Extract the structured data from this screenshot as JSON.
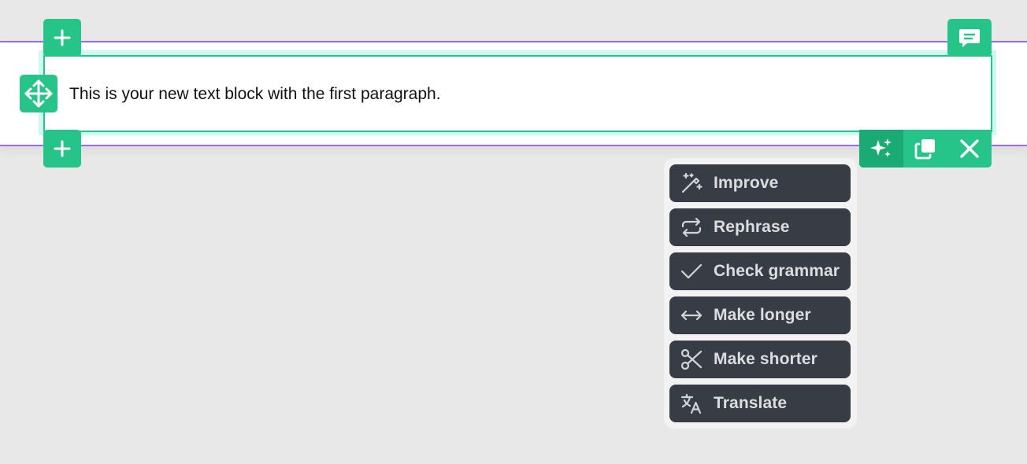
{
  "block": {
    "text": "This is your new text block with the first paragraph."
  },
  "controls": {
    "add_above_icon": "plus-icon",
    "add_below_icon": "plus-icon",
    "move_icon": "move-arrows-icon",
    "comment_icon": "comment-icon"
  },
  "toolbar": {
    "ai_icon": "sparkles-icon",
    "duplicate_icon": "duplicate-icon",
    "delete_icon": "close-icon"
  },
  "ai_menu": {
    "items": [
      {
        "label": "Improve",
        "icon": "magic-wand-icon"
      },
      {
        "label": "Rephrase",
        "icon": "repeat-icon"
      },
      {
        "label": "Check grammar",
        "icon": "checkmark-icon"
      },
      {
        "label": "Make longer",
        "icon": "horizontal-arrows-icon"
      },
      {
        "label": "Make shorter",
        "icon": "scissors-icon"
      },
      {
        "label": "Translate",
        "icon": "translate-icon"
      }
    ]
  },
  "colors": {
    "accent": "#27c48a",
    "selection_line": "#9a6bf0",
    "menu_item_bg": "#383c45",
    "menu_text": "#dcdde0"
  }
}
